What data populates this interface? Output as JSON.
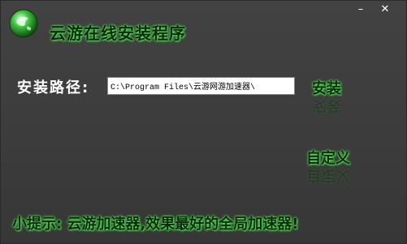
{
  "window": {
    "title": "云游在线安装程序",
    "minimize_label": "–",
    "close_label": "✕"
  },
  "form": {
    "path_label": "安装路径:",
    "path_value": "C:\\Program Files\\云游网游加速器\\"
  },
  "buttons": {
    "install_label": "安装",
    "custom_label": "自定义"
  },
  "footer": {
    "tip_text": "小提示: 云游加速器,效果最好的全局加速器!"
  },
  "colors": {
    "background": "#3b3b3b",
    "glow_green": "#4ad04a",
    "text_dark": "#0c2a0c",
    "label_white": "#ffffff"
  },
  "icons": {
    "logo": "green-globe-logo-icon"
  }
}
